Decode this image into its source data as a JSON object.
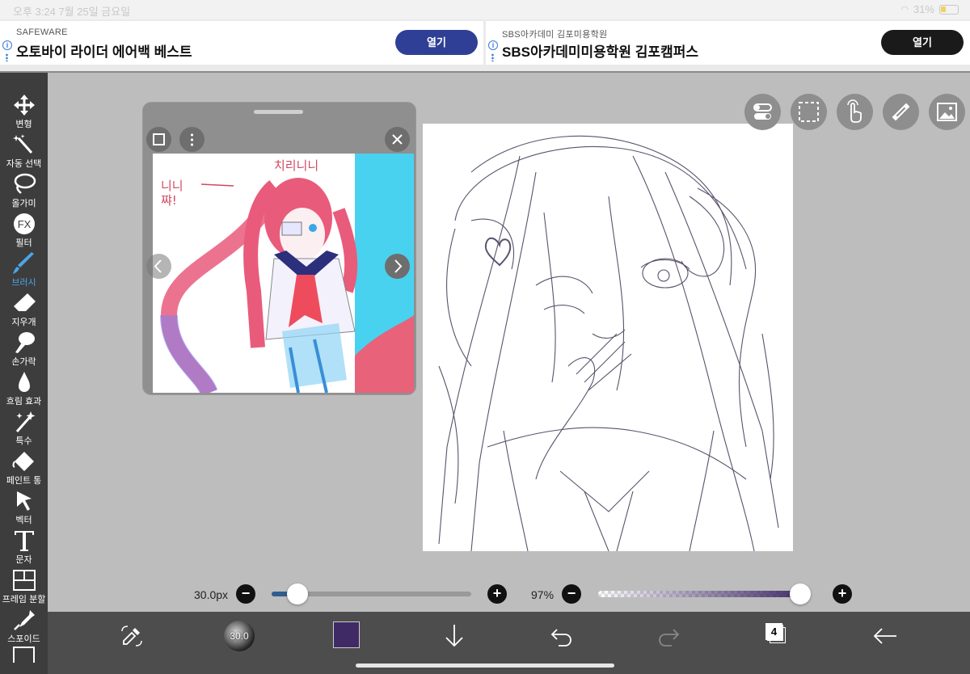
{
  "status_bar": {
    "time_text": "오후 3:24   7월 25일 금요일",
    "battery_text": "31%"
  },
  "ads": [
    {
      "advertiser": "SAFEWARE",
      "title": "오토바이 라이더 에어백 베스트",
      "button": "열기",
      "button_color": "#2f3f96"
    },
    {
      "advertiser": "SBS아카데미 김포미용학원",
      "title": "SBS아카데미미용학원 김포캠퍼스",
      "button": "열기",
      "button_color": "#1a1a1a"
    }
  ],
  "tools": [
    {
      "label": "변형",
      "icon": "move-arrows-icon"
    },
    {
      "label": "자동 선택",
      "icon": "magic-wand-icon"
    },
    {
      "label": "올가미",
      "icon": "lasso-icon"
    },
    {
      "label": "필터",
      "icon": "fx-icon"
    },
    {
      "label": "브러시",
      "icon": "brush-icon",
      "active": true
    },
    {
      "label": "지우개",
      "icon": "eraser-icon"
    },
    {
      "label": "손가락",
      "icon": "smudge-finger-icon"
    },
    {
      "label": "흐림 효과",
      "icon": "blur-drop-icon"
    },
    {
      "label": "특수",
      "icon": "sparkle-icon"
    },
    {
      "label": "페인트 통",
      "icon": "paint-bucket-icon"
    },
    {
      "label": "벡터",
      "icon": "vector-cursor-icon"
    },
    {
      "label": "문자",
      "icon": "text-t-icon"
    },
    {
      "label": "프레임 분할",
      "icon": "frame-split-icon"
    },
    {
      "label": "스포이드",
      "icon": "eyedropper-icon"
    }
  ],
  "reference_panel": {
    "handwriting_left": "니니\n쨔!",
    "handwriting_top": "치리니니"
  },
  "brush": {
    "size_label": "30.0px",
    "size_badge": "30.0",
    "opacity_label": "97%",
    "size_fraction": 0.13,
    "opacity_fraction": 0.97,
    "color": "#3f2a66"
  },
  "accent_colors": {
    "active_tool": "#4aa6e8",
    "size_fill": "#2f5d8f"
  },
  "bottom_bar": {
    "layers_count": "4"
  }
}
